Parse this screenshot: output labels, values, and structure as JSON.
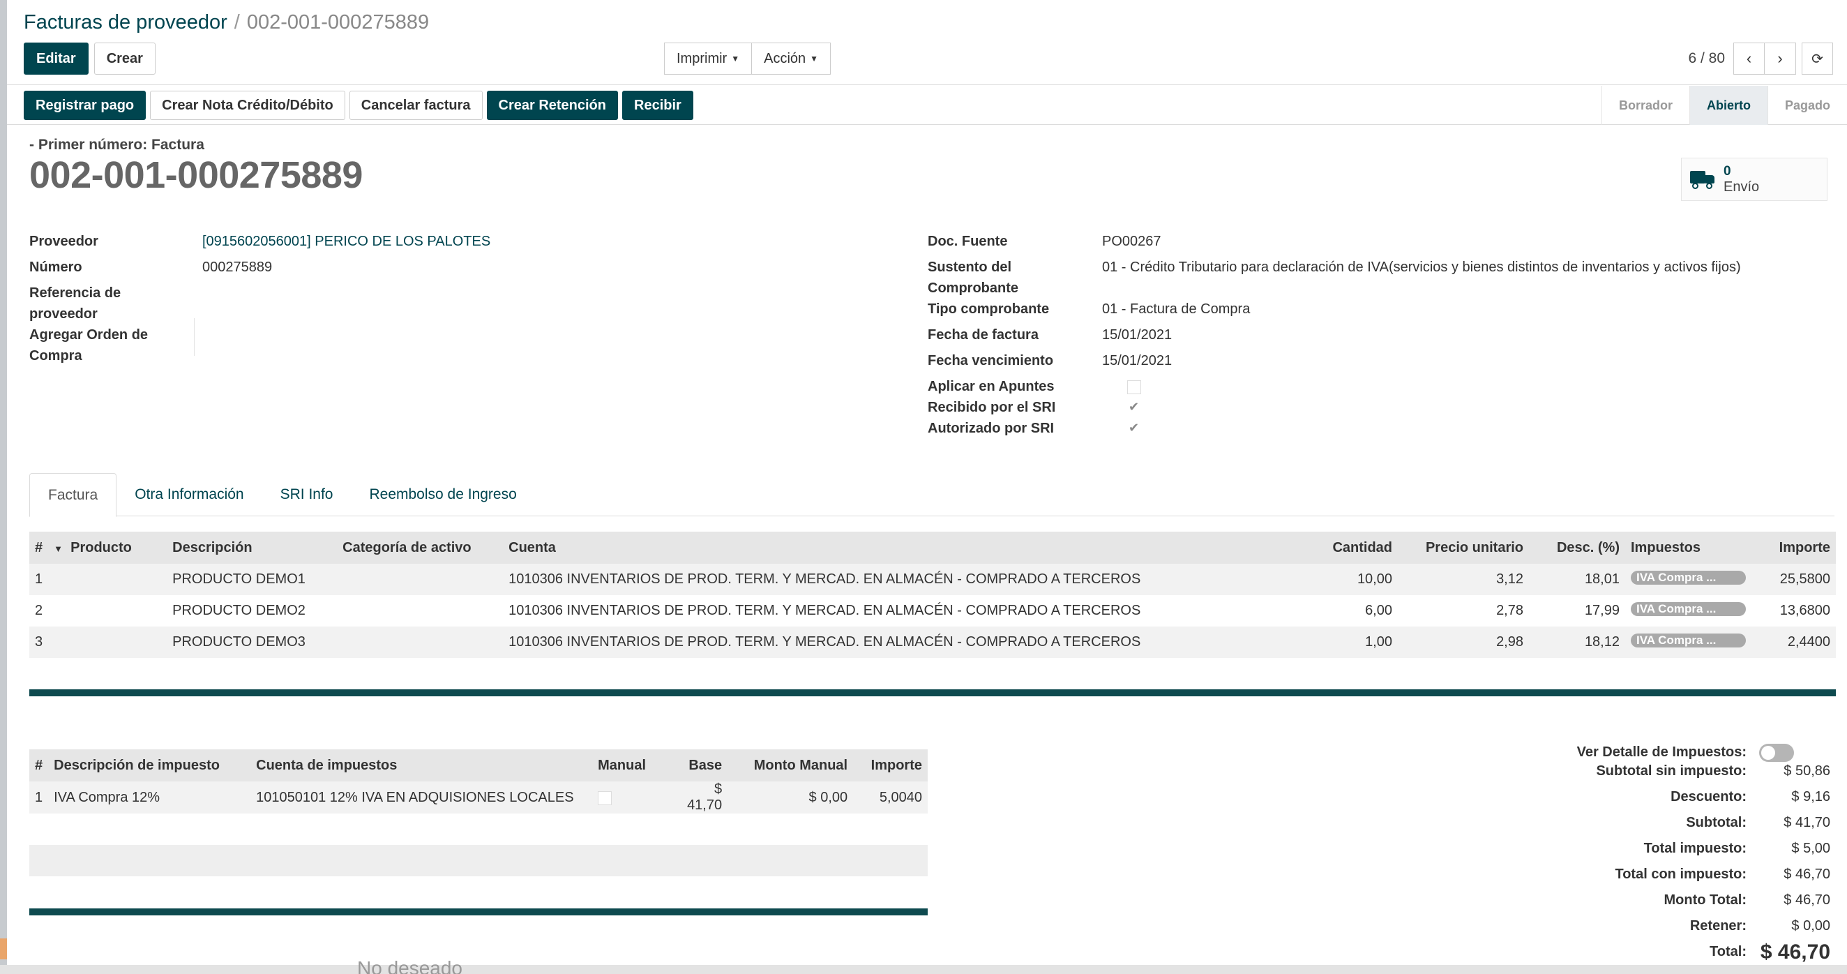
{
  "breadcrumb": {
    "parent": "Facturas de proveedor",
    "separator": "/",
    "current": "002-001-000275889"
  },
  "controlpanel": {
    "edit_label": "Editar",
    "create_label": "Crear",
    "print_label": "Imprimir",
    "action_label": "Acción",
    "pager": "6 / 80"
  },
  "statusbar": {
    "buttons": [
      "Registrar pago",
      "Crear Nota Crédito/Débito",
      "Cancelar factura",
      "Crear Retención",
      "Recibir"
    ],
    "stages": [
      "Borrador",
      "Abierto",
      "Pagado"
    ],
    "active_stage": "Abierto"
  },
  "header": {
    "first_number": "- Primer número: Factura",
    "title": "002-001-000275889",
    "shipment_count": "0",
    "shipment_label": "Envío"
  },
  "left_fields": {
    "proveedor_label": "Proveedor",
    "proveedor_value": "[0915602056001] PERICO DE LOS PALOTES",
    "numero_label": "Número",
    "numero_value": "000275889",
    "referencia_label_1": "Referencia de",
    "referencia_label_2": "proveedor",
    "orden_label_1": "Agregar Orden de",
    "orden_label_2": "Compra"
  },
  "right_fields": {
    "doc_fuente_label": "Doc. Fuente",
    "doc_fuente_value": "PO00267",
    "sustento_label_1": "Sustento del",
    "sustento_label_2": "Comprobante",
    "sustento_value": "01 - Crédito Tributario para declaración de IVA(servicios y bienes distintos de inventarios y activos fijos)",
    "tipo_label": "Tipo comprobante",
    "tipo_value": "01 - Factura de Compra",
    "fecha_factura_label": "Fecha de factura",
    "fecha_factura_value": "15/01/2021",
    "fecha_venc_label": "Fecha vencimiento",
    "fecha_venc_value": "15/01/2021",
    "aplicar_label": "Aplicar en Apuntes",
    "recibido_label": "Recibido por el SRI",
    "autorizado_label": "Autorizado por SRI"
  },
  "tabs": [
    "Factura",
    "Otra Información",
    "SRI Info",
    "Reembolso de Ingreso"
  ],
  "lines": {
    "headers": [
      "#",
      "Producto",
      "Descripción",
      "Categoría de activo",
      "Cuenta",
      "Cantidad",
      "Precio unitario",
      "Desc. (%)",
      "Impuestos",
      "Importe"
    ],
    "rows": [
      [
        "1",
        "",
        "PRODUCTO DEMO1",
        "",
        "1010306 INVENTARIOS DE PROD. TERM. Y MERCAD. EN ALMACÉN - COMPRADO A TERCEROS",
        "10,00",
        "3,12",
        "18,01",
        "IVA Compra ...",
        "25,5800"
      ],
      [
        "2",
        "",
        "PRODUCTO DEMO2",
        "",
        "1010306 INVENTARIOS DE PROD. TERM. Y MERCAD. EN ALMACÉN - COMPRADO A TERCEROS",
        "6,00",
        "2,78",
        "17,99",
        "IVA Compra ...",
        "13,6800"
      ],
      [
        "3",
        "",
        "PRODUCTO DEMO3",
        "",
        "1010306 INVENTARIOS DE PROD. TERM. Y MERCAD. EN ALMACÉN - COMPRADO A TERCEROS",
        "1,00",
        "2,98",
        "18,12",
        "IVA Compra ...",
        "2,4400"
      ]
    ]
  },
  "taxes": {
    "headers": [
      "#",
      "Descripción de impuesto",
      "Cuenta de impuestos",
      "Manual",
      "Base",
      "Monto Manual",
      "Importe"
    ],
    "rows": [
      [
        "1",
        "IVA Compra 12%",
        "101050101 12% IVA EN ADQUISIONES LOCALES",
        "",
        "$ 41,70",
        "$ 0,00",
        "5,0040"
      ]
    ]
  },
  "totals": {
    "detalle_label": "Ver Detalle de Impuestos:",
    "subtotal_sin_label": "Subtotal sin impuesto:",
    "subtotal_sin_value": "$ 50,86",
    "descuento_label": "Descuento:",
    "descuento_value": "$ 9,16",
    "subtotal_label": "Subtotal:",
    "subtotal_value": "$ 41,70",
    "total_impuesto_label": "Total impuesto:",
    "total_impuesto_value": "$ 5,00",
    "total_con_label": "Total con impuesto:",
    "total_con_value": "$ 46,70",
    "monto_total_label": "Monto Total:",
    "monto_total_value": "$ 46,70",
    "retener_label": "Retener:",
    "retener_value": "$ 0,00",
    "total_label": "Total:",
    "total_value": "$ 46,70"
  },
  "background": {
    "peek_text": "No deseado"
  }
}
